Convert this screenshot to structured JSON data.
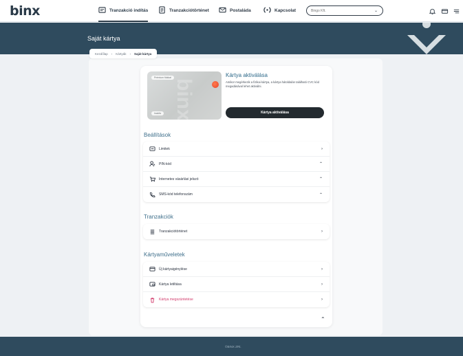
{
  "app": {
    "logo": "binx"
  },
  "nav": {
    "items": [
      {
        "label": "Tranzakció indítás",
        "icon": "transfer-icon"
      },
      {
        "label": "Tranzakciótörténet",
        "icon": "history-icon"
      },
      {
        "label": "Postaláda",
        "icon": "mail-icon"
      },
      {
        "label": "Kapcsolat",
        "icon": "contact-icon"
      }
    ],
    "search_placeholder": "Bingo Kft."
  },
  "header": {
    "title": "Saját kártya"
  },
  "breadcrumb": {
    "items": [
      "Kezdőlap",
      "Kártyák",
      "Saját kártya"
    ]
  },
  "card_visual": {
    "badge_top": "Prémium fiókkal",
    "badge_bottom": "Inaktív",
    "watermark": "binx"
  },
  "activation": {
    "title": "Kártya aktiválása",
    "description": "Amikor megérkezik a fizikai kártya, a kártya hátoldalán található CVC kód megadásával lehet aktiválni.",
    "button": "Kártya aktiválása"
  },
  "settings": {
    "title": "Beállítások",
    "rows": [
      {
        "label": "Limitek",
        "icon": "limits-icon",
        "arrow": "›"
      },
      {
        "label": "PIN-kód",
        "icon": "pin-icon",
        "arrow": "⌃"
      },
      {
        "label": "Internetes vásárlási jelszó",
        "icon": "cart-icon",
        "arrow": "⌃"
      },
      {
        "label": "SMS-kód telefonszám",
        "icon": "phone-icon",
        "arrow": "⌃"
      }
    ]
  },
  "transactions": {
    "title": "Tranzakciók",
    "rows": [
      {
        "label": "Tranzakciótörténet",
        "icon": "list-icon",
        "arrow": "›"
      }
    ]
  },
  "card_ops": {
    "title": "Kártyaműveletek",
    "rows": [
      {
        "label": "Új kártyaigénylése",
        "icon": "new-card-icon",
        "arrow": "›"
      },
      {
        "label": "Kártya letiltása",
        "icon": "block-card-icon",
        "arrow": "›"
      },
      {
        "label": "Kártya megszüntetése",
        "icon": "trash-icon",
        "arrow": "›"
      }
    ]
  },
  "collapse_arrow": "⌃",
  "footer": {
    "text": "©BINX ZRt."
  },
  "colors": {
    "brand_dark": "#2f4b5e",
    "accent_title": "#3f6f8b",
    "danger": "#d23b6c",
    "button_dark": "#232a2f"
  }
}
